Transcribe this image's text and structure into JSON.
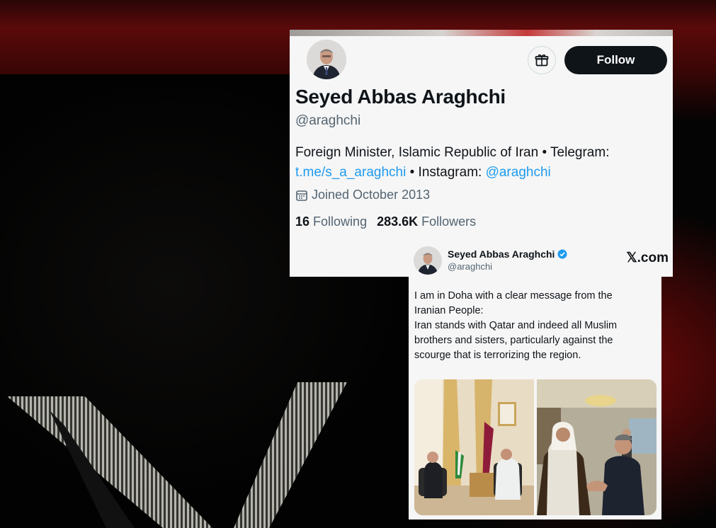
{
  "profile": {
    "name": "Seyed Abbas Araghchi",
    "handle": "@araghchi",
    "follow_label": "Follow",
    "gift_icon": "gift-icon",
    "bio": {
      "prefix": "Foreign Minister, Islamic Republic of Iran • Telegram: ",
      "telegram_link": "t.me/s_a_araghchi",
      "middle": " • Instagram: ",
      "instagram_link": "@araghchi"
    },
    "joined": "Joined October 2013",
    "calendar_icon": "calendar-icon",
    "following_count": "16",
    "following_label": "Following",
    "followers_count": "283.6K",
    "followers_label": "Followers"
  },
  "tweet": {
    "author_name": "Seyed Abbas Araghchi",
    "author_handle": "@araghchi",
    "verified_icon": "verified-badge-icon",
    "source": "𝕏.com",
    "text": "I am in Doha with a clear message from the\nIranian People:\nIran stands with Qatar and indeed all Muslim\nbrothers and sisters, particularly against the\nscourge that is terrorizing the region.",
    "photos": [
      "meeting-photo",
      "handshake-photo"
    ]
  },
  "colors": {
    "link": "#1d9bf0",
    "follow_bg": "#0f1419",
    "card_bg": "#f6f6f6",
    "muted": "#536471"
  }
}
